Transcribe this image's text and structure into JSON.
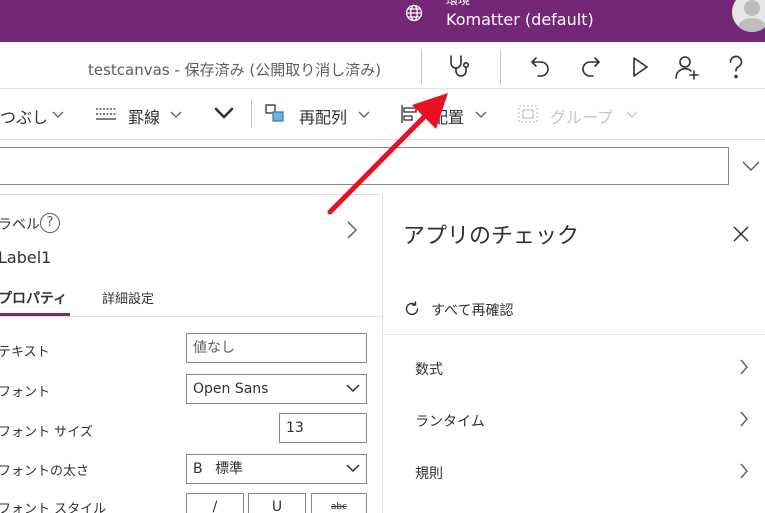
{
  "header": {
    "env_label": "環境",
    "env_name": "Komatter (default)"
  },
  "title_row": {
    "app_title": "testcanvas - 保存済み (公開取り消し済み)"
  },
  "ribbon": {
    "fill_label": "つぶし",
    "border_label": "罫線",
    "reorder_label": "再配列",
    "align_label": "配置",
    "group_label": "グループ"
  },
  "left_pane": {
    "control_type": "ラベル",
    "control_name": "Label1",
    "tabs": [
      {
        "label": "プロパティ"
      },
      {
        "label": "詳細設定"
      }
    ],
    "props": {
      "text_label": "テキスト",
      "text_placeholder": "値なし",
      "font_label": "フォント",
      "font_value": "Open Sans",
      "font_size_label": "フォント サイズ",
      "font_size_value": "13",
      "font_weight_label": "フォントの太さ",
      "font_weight_prefix": "B",
      "font_weight_value": "標準",
      "font_style_label": "フォント スタイル",
      "style_italic": "/",
      "style_underline": "U",
      "style_strike": "abc"
    }
  },
  "right_pane": {
    "title": "アプリのチェック",
    "recheck_label": "すべて再確認",
    "items": [
      {
        "label": "数式"
      },
      {
        "label": "ランタイム"
      },
      {
        "label": "規則"
      }
    ]
  },
  "colors": {
    "brand_purple": "#742774",
    "arrow_red": "#e81123"
  }
}
